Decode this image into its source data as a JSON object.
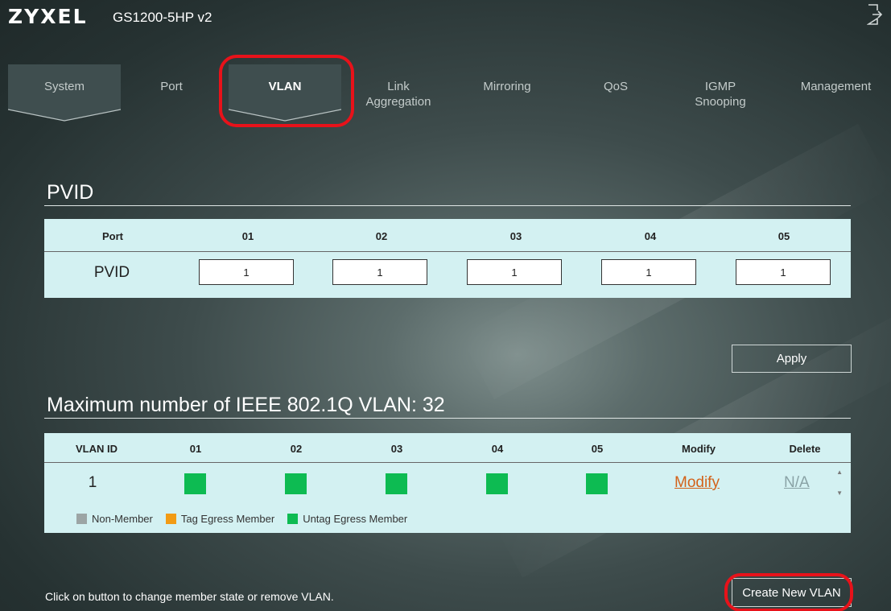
{
  "header": {
    "brand": "ZYXEL",
    "model": "GS1200-5HP v2",
    "logout_icon": "logout-icon"
  },
  "nav": {
    "tabs": [
      {
        "label": "System",
        "active": false
      },
      {
        "label": "Port",
        "active": false
      },
      {
        "label": "VLAN",
        "active": true
      },
      {
        "label": "Link\nAggregation",
        "active": false
      },
      {
        "label": "Mirroring",
        "active": false
      },
      {
        "label": "QoS",
        "active": false
      },
      {
        "label": "IGMP\nSnooping",
        "active": false
      },
      {
        "label": "Management",
        "active": false
      }
    ]
  },
  "pvid": {
    "title": "PVID",
    "header_port": "Port",
    "ports": [
      "01",
      "02",
      "03",
      "04",
      "05"
    ],
    "row_label": "PVID",
    "values": [
      "1",
      "1",
      "1",
      "1",
      "1"
    ],
    "apply_label": "Apply"
  },
  "vlan": {
    "title": "Maximum number of IEEE 802.1Q VLAN: 32",
    "columns": [
      "VLAN ID",
      "01",
      "02",
      "03",
      "04",
      "05",
      "Modify",
      "Delete"
    ],
    "rows": [
      {
        "vlan_id": "1",
        "members": [
          "untag",
          "untag",
          "untag",
          "untag",
          "untag"
        ],
        "modify": "Modify",
        "delete": "N/A"
      }
    ],
    "legend": [
      {
        "label": "Non-Member",
        "color": "#9ca5a5"
      },
      {
        "label": "Tag Egress Member",
        "color": "#f29b14"
      },
      {
        "label": "Untag Egress Member",
        "color": "#0dbb52"
      }
    ]
  },
  "footer": {
    "hint": "Click on button to change member state or remove VLAN.",
    "create_label": "Create New VLAN"
  },
  "colors": {
    "panel": "#d3f1f2",
    "highlight": "#e8121a",
    "modify_link": "#d3621a",
    "untag_member": "#0dbb52"
  }
}
